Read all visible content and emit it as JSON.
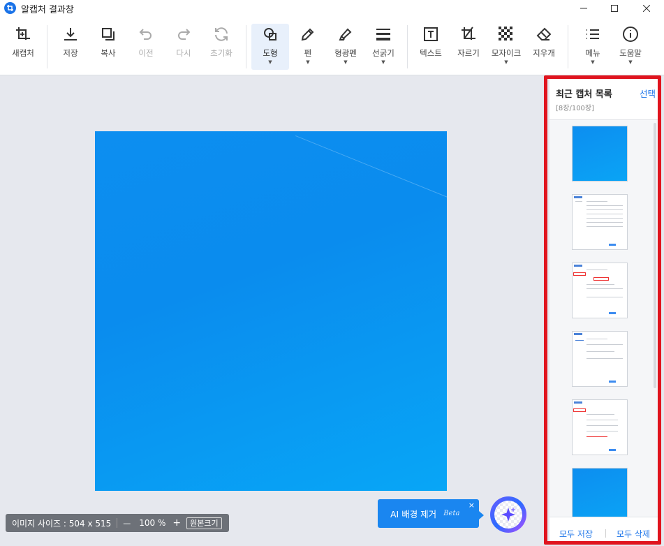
{
  "window": {
    "title": "알캡처 결과창"
  },
  "toolbar": {
    "new_capture": "새캡처",
    "save": "저장",
    "copy": "복사",
    "undo": "이전",
    "redo": "다시",
    "reset": "초기화",
    "shape": "도형",
    "pen": "펜",
    "highlighter": "형광펜",
    "line_width": "선굵기",
    "text": "텍스트",
    "crop": "자르기",
    "mosaic": "모자이크",
    "eraser": "지우개",
    "menu": "메뉴",
    "help": "도움말"
  },
  "status": {
    "size_label": "이미지 사이즈 : 504 x 515",
    "zoom_minus": "—",
    "zoom": "100 %",
    "zoom_plus": "+",
    "original_size": "원본크기"
  },
  "ai": {
    "label": "AI 배경 제거",
    "beta": "Beta",
    "close": "×"
  },
  "panel": {
    "title": "최근 캡처 목록",
    "select": "선택",
    "count": "[8장/100장]",
    "save_all": "모두 저장",
    "delete_all": "모두 삭제"
  },
  "colors": {
    "accent": "#1a73e8",
    "highlight": "#e0141e",
    "capture_blue": "#0a8cee"
  },
  "icons": [
    "crop-add-icon",
    "download-icon",
    "copy-icon",
    "undo-icon",
    "redo-icon",
    "reset-icon",
    "shape-icon",
    "pen-icon",
    "highlighter-icon",
    "line-width-icon",
    "text-icon",
    "crop-icon",
    "mosaic-icon",
    "eraser-icon",
    "menu-icon",
    "help-icon",
    "sparkle-icon"
  ]
}
